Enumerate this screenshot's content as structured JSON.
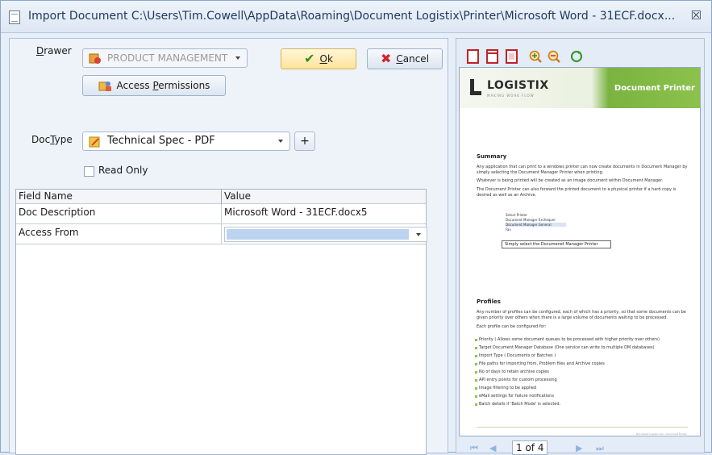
{
  "window": {
    "title": "Import Document C:\\Users\\Tim.Cowell\\AppData\\Roaming\\Document Logistix\\Printer\\Microsoft Word - 31ECF.docx..."
  },
  "form": {
    "drawer_label_u": "D",
    "drawer_label_rest": "rawer",
    "drawer_value": "PRODUCT MANAGEMENT",
    "ok_label_u": "O",
    "ok_label_rest": "k",
    "cancel_label_u": "C",
    "cancel_label_rest": "ancel",
    "access_permissions_pre": "Access ",
    "access_permissions_u": "P",
    "access_permissions_rest": "ermissions",
    "doctype_label_pre": "Doc",
    "doctype_label_u": "T",
    "doctype_label_rest": "ype",
    "doctype_value": "Technical Spec - PDF",
    "plus_label": "+",
    "read_only_label": "Read Only"
  },
  "grid": {
    "headers": [
      "Field Name",
      "Value"
    ],
    "rows": [
      {
        "field": "Doc Description",
        "value": "Microsoft Word - 31ECF.docx5"
      },
      {
        "field": "Access From",
        "value": ""
      }
    ]
  },
  "preview": {
    "logo": "LOGISTIX",
    "logo_sub": "MAKING WORK FLOW",
    "banner_title": "Document Printer",
    "summary_heading": "Summary",
    "summary_p1": "Any application that can print to a windows printer can now create documents in Document Manager by simply selecting the Document Manager Printer when printing.",
    "summary_p2": "Whatever is being printed will be created as an image document within Document Manager.",
    "summary_p3": "The Document Printer can also forward the printed document to a physical printer if a hard copy is desired as well as an Archive.",
    "mini_list": [
      "Select Printer",
      "Document Manager Exchequer",
      "Document Manager General",
      "Fax"
    ],
    "caption": "Simply select the Documenet Manager Printer",
    "profiles_heading": "Profiles",
    "profiles_p1": "Any number of profiles can be configured, each of which has a priority, so that some documents can be given priority over others when there is a large volume of documents waiting to be processed.",
    "profiles_p2": "Each profile can be configured for:",
    "bullets": [
      "Priority ( Allows some document queues to be processed with higher priority over others)",
      "Target Document Manager Database (One service can write to multiple DM databases)",
      "Import Type ( Documents or Batches )",
      "File paths for importing from, Problem files and Archive copies",
      "No of days to retain archive copies",
      "API entry points for custom processing",
      "Image filtering to be applied",
      "eMail settings for failure notifications",
      "Batch details if 'Batch Mode' is selected."
    ],
    "footer": "Document Logistix Ltd - Document Printer"
  },
  "nav": {
    "page_indicator": "1 of 4"
  }
}
